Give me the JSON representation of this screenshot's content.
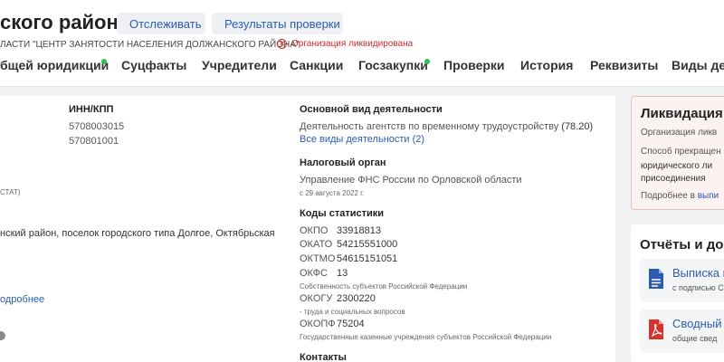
{
  "header": {
    "title": "ского района\"",
    "track_button": "Отслеживать",
    "results_button": "Результаты проверки",
    "subline": "ЛАСТИ \"ЦЕНТР ЗАНЯТОСТИ НАСЕЛЕНИЯ ДОЛЖАНСКОГО РАЙОНА\"",
    "status_badge": "Организация ликвидирована"
  },
  "tabs": [
    {
      "label": "бщей юридикции"
    },
    {
      "label": "Суцфакты"
    },
    {
      "label": "Учредители"
    },
    {
      "label": "Санкции"
    },
    {
      "label": "Госзакупки"
    },
    {
      "label": "Проверки"
    },
    {
      "label": "История"
    },
    {
      "label": "Реквизиты"
    },
    {
      "label": "Виды дея"
    }
  ],
  "left": {
    "inn_kpp_label": "ИНН/КПП",
    "inn": "5708003015",
    "kpp": "570801001",
    "stat_fragment": "СТАТ)",
    "address": "нский район, поселок городского типа Долгое, Октябрьская",
    "more_link": "одробнее"
  },
  "activity": {
    "label": "Основной вид деятельности",
    "text": "Деятельность агентств по временному трудоустройству",
    "code": "(78.20)",
    "all_link": "Все виды деятельности (2)"
  },
  "tax": {
    "label": "Налоговый орган",
    "name": "Управление ФНС России по Орловской области",
    "date": "с 29 августа 2022 г."
  },
  "stats": {
    "label": "Коды статистики",
    "okpo_k": "ОКПО",
    "okpo_v": "33918813",
    "okato_k": "ОКАТО",
    "okato_v": "54215551000",
    "oktmo_k": "ОКТМО",
    "oktmo_v": "54615151051",
    "okfs_k": "ОКФС",
    "okfs_v": "13",
    "okfs_desc": "Собственность субъектов Российской Федерации",
    "okogu_k": "ОКОГУ",
    "okogu_v": "2300220",
    "okogu_desc": "- труда и социальных вопросов",
    "okopf_k": "ОКОПФ",
    "okopf_v": "75204",
    "okopf_desc": "Государственные казенные учреждения субъектов Российской Федерации"
  },
  "contacts": {
    "label": "Контакты"
  },
  "liquidation": {
    "title": "Ликвидация",
    "line1": "Организация ликв",
    "line2": "Способ прекращен",
    "line3": "юридического ли",
    "line4": "присоединения",
    "more_prefix": "Подробнее в",
    "more_link": "выпи"
  },
  "reports": {
    "title": "Отчёты и до",
    "item1_name": "Выписка и",
    "item1_sub": "с подписью С",
    "item2_name": "Сводный",
    "item2_sub": "общие свед"
  },
  "colors": {
    "accent": "#2a5db0",
    "danger": "#d12b2b",
    "dot_green": "#2ec04b"
  }
}
